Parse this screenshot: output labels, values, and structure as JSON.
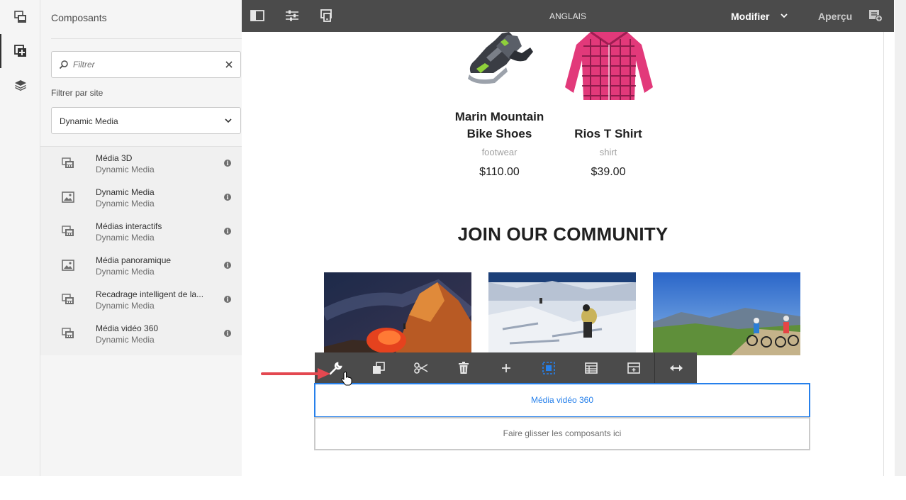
{
  "rail": {
    "items": [
      {
        "icon": "assets-icon",
        "active": false
      },
      {
        "icon": "components-icon",
        "active": true
      },
      {
        "icon": "content-tree-icon",
        "active": false
      }
    ]
  },
  "panel": {
    "title": "Composants",
    "filter_placeholder": "Filtrer",
    "site_filter_label": "Filtrer par site",
    "site_selected": "Dynamic Media",
    "components": [
      {
        "name": "Média 3D",
        "group": "Dynamic Media",
        "icon": "film-icon"
      },
      {
        "name": "Dynamic Media",
        "group": "Dynamic Media",
        "icon": "image-icon"
      },
      {
        "name": "Médias interactifs",
        "group": "Dynamic Media",
        "icon": "film-icon"
      },
      {
        "name": "Média panoramique",
        "group": "Dynamic Media",
        "icon": "image-icon"
      },
      {
        "name": "Recadrage intelligent de la...",
        "group": "Dynamic Media",
        "icon": "film-icon"
      },
      {
        "name": "Média vidéo 360",
        "group": "Dynamic Media",
        "icon": "film-icon"
      }
    ]
  },
  "topbar": {
    "language": "ANGLAIS",
    "mode": "Modifier",
    "preview": "Aperçu"
  },
  "page": {
    "products": [
      {
        "name": "Marin Mountain Bike Shoes",
        "category": "footwear",
        "price": "$110.00"
      },
      {
        "name": "Rios T Shirt",
        "category": "shirt",
        "price": "$39.00"
      }
    ],
    "community_heading": "JOIN OUR COMMUNITY",
    "selected_component": "Média vidéo 360",
    "drop_zone": "Faire glisser les composants ici"
  },
  "toolbar": {
    "buttons": [
      "configure",
      "copy",
      "cut",
      "delete",
      "insert",
      "select-parent",
      "layout",
      "group",
      "resize"
    ]
  },
  "colors": {
    "topbar": "#4b4b4b",
    "accent": "#2680eb",
    "arrow": "#e34850"
  }
}
